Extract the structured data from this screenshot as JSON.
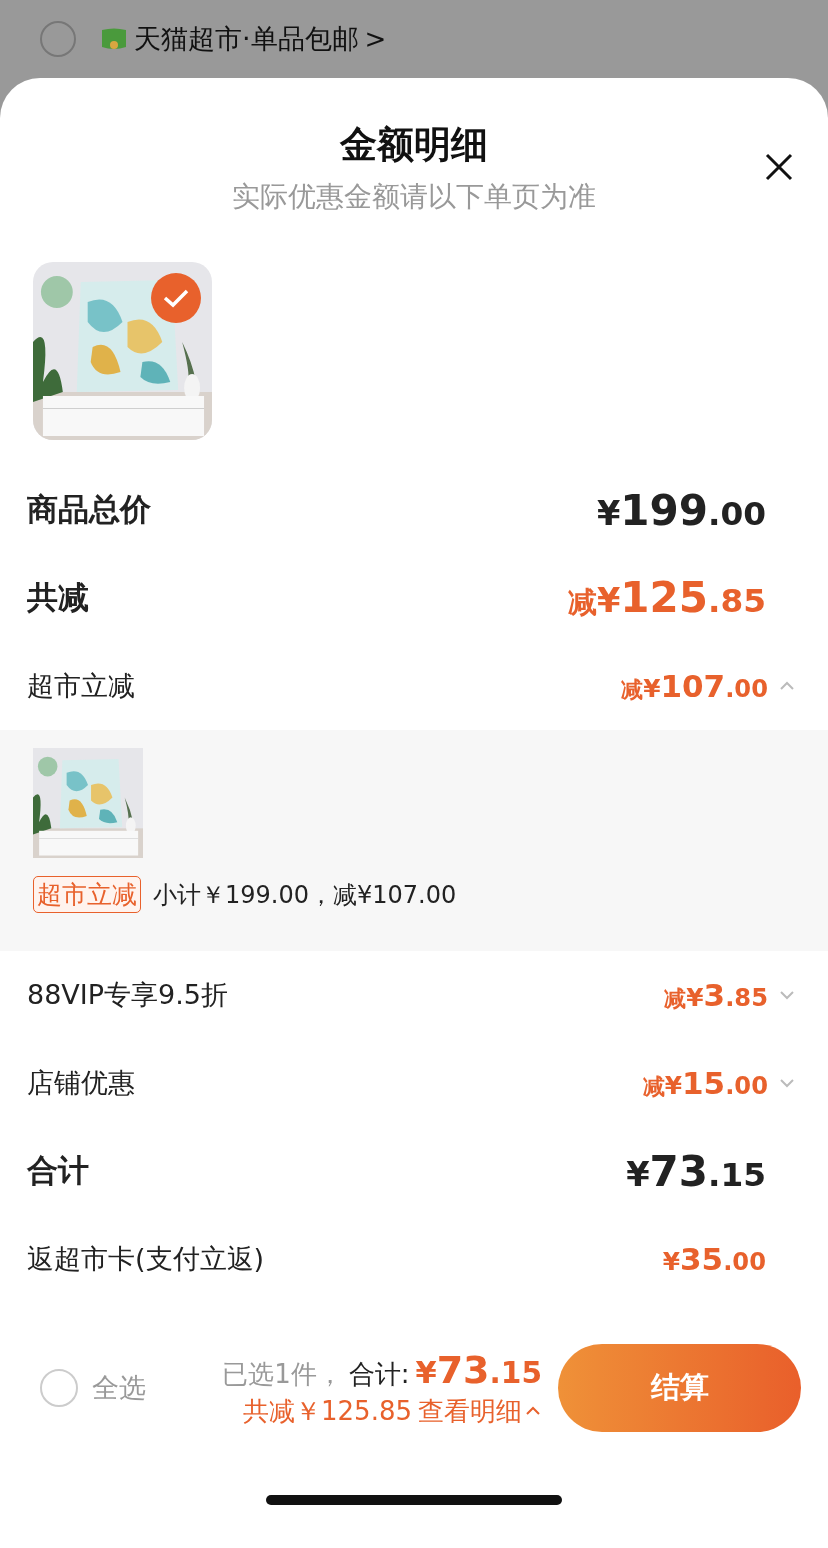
{
  "store_header": {
    "checked": false,
    "store_name": "天猫超市·单品包邮",
    "chevron": ">"
  },
  "sheet": {
    "title": "金额明细",
    "subtitle": "实际优惠金额请以下单页为准"
  },
  "product": {
    "kind": "picture",
    "selected": true
  },
  "rows": [
    {
      "kind": "major",
      "label": "商品总价",
      "discount": false,
      "prefix": "",
      "currency": "¥",
      "value": "199.00"
    },
    {
      "kind": "major",
      "label": "共减",
      "discount": true,
      "prefix": "减",
      "currency": "¥",
      "value": "125.85"
    },
    {
      "kind": "collapsible",
      "label": "超市立减",
      "discount": true,
      "prefix": "减",
      "currency": "¥",
      "value": "107.00",
      "expanded": true,
      "detail": {
        "tag": "超市立减",
        "text": "小计￥199.00，减¥107.00"
      }
    },
    {
      "kind": "collapsible",
      "label": "88VIP专享9.5折",
      "discount": true,
      "prefix": "减",
      "currency": "¥",
      "value": "3.85",
      "expanded": false
    },
    {
      "kind": "collapsible",
      "label": "店铺优惠",
      "discount": true,
      "prefix": "减",
      "currency": "¥",
      "value": "15.00",
      "expanded": false
    },
    {
      "kind": "major",
      "label": "合计",
      "discount": false,
      "prefix": "",
      "currency": "¥",
      "value": "73.15"
    },
    {
      "kind": "minor",
      "label": "返超市卡(支付立返)",
      "discount": true,
      "prefix": "",
      "currency": "¥",
      "value": "35.00"
    }
  ],
  "checkout": {
    "select_all": {
      "label": "全选",
      "checked": false
    },
    "selected_count": "已选1件，",
    "total_label": "合计:",
    "total_currency": "¥",
    "total_value": "73.15",
    "savings": "共减￥125.85",
    "details_link": "查看明细",
    "details_expanded": true,
    "button": "结算"
  }
}
